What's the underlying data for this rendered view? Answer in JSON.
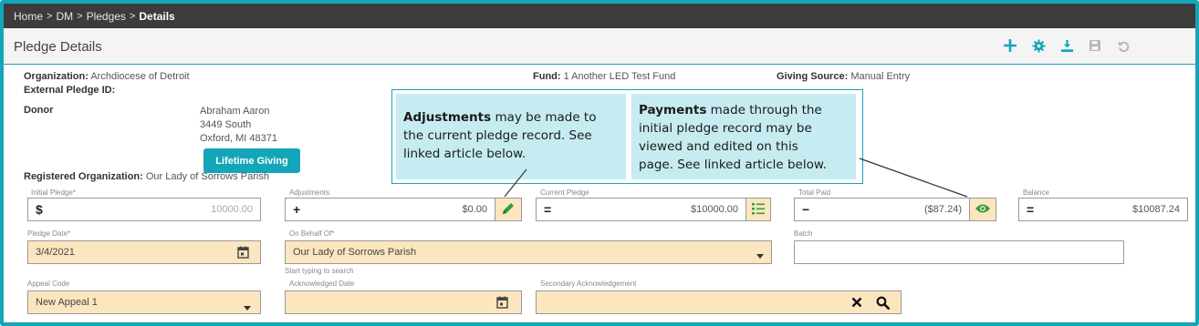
{
  "breadcrumb": {
    "items": [
      "Home",
      "DM",
      "Pledges"
    ],
    "current": "Details",
    "separator": ">"
  },
  "header": {
    "title": "Pledge Details"
  },
  "toolbar": {
    "icons": [
      "plus-icon",
      "gear-icon",
      "download-icon",
      "save-icon",
      "undo-icon"
    ]
  },
  "info": {
    "organization_label": "Organization:",
    "organization_value": "Archdiocese of Detroit",
    "external_id_label": "External Pledge ID:",
    "fund_label": "Fund:",
    "fund_value": "1 Another LED Test Fund",
    "giving_source_label": "Giving Source:",
    "giving_source_value": "Manual Entry",
    "donor_label": "Donor",
    "donor_name": "Abraham Aaron",
    "donor_addr1": "3449 South",
    "donor_addr2": "Oxford, MI 48371",
    "lifetime_button": "Lifetime Giving",
    "registered_org_label": "Registered Organization:",
    "registered_org_value": "Our Lady of Sorrows Parish"
  },
  "callouts": {
    "adjustments_bold": "Adjustments",
    "adjustments_rest_1": " may be made to",
    "adjustments_rest_2": "the current pledge record. See",
    "adjustments_rest_3": "linked article below.",
    "payments_bold": "Payments",
    "payments_rest_1": " made through the",
    "payments_rest_2": "initial pledge record may be",
    "payments_rest_3": "viewed and edited on this",
    "payments_rest_4": "page. See linked article below."
  },
  "fields": {
    "initial_pledge": {
      "label": "Initial Pledge*",
      "symbol": "$",
      "value": "10000.00"
    },
    "adjustments": {
      "label": "Adjustments",
      "symbol": "+",
      "value": "$0.00"
    },
    "current_pledge": {
      "label": "Current Pledge",
      "symbol": "=",
      "value": "$10000.00"
    },
    "total_paid": {
      "label": "Total Paid",
      "symbol": "−",
      "value": "($87.24)"
    },
    "balance": {
      "label": "Balance",
      "symbol": "=",
      "value": "$10087.24"
    },
    "pledge_date": {
      "label": "Pledge Date*",
      "value": "3/4/2021"
    },
    "on_behalf_of": {
      "label": "On Behalf Of*",
      "value": "Our Lady of Sorrows Parish",
      "helper": "Start typing to search"
    },
    "batch": {
      "label": "Batch",
      "value": ""
    },
    "appeal_code": {
      "label": "Appeal Code",
      "value": "New Appeal 1"
    },
    "acknowledged_date": {
      "label": "Acknowledged Date",
      "value": ""
    },
    "secondary_ack": {
      "label": "Secondary Acknowledgement",
      "value": ""
    }
  },
  "colors": {
    "accent": "#14a6b8",
    "field_yellow": "#fbe6bf",
    "callout_bg": "#c6ecf2",
    "topbar": "#3c3c3c",
    "pencil_green": "#2e9e3e"
  }
}
